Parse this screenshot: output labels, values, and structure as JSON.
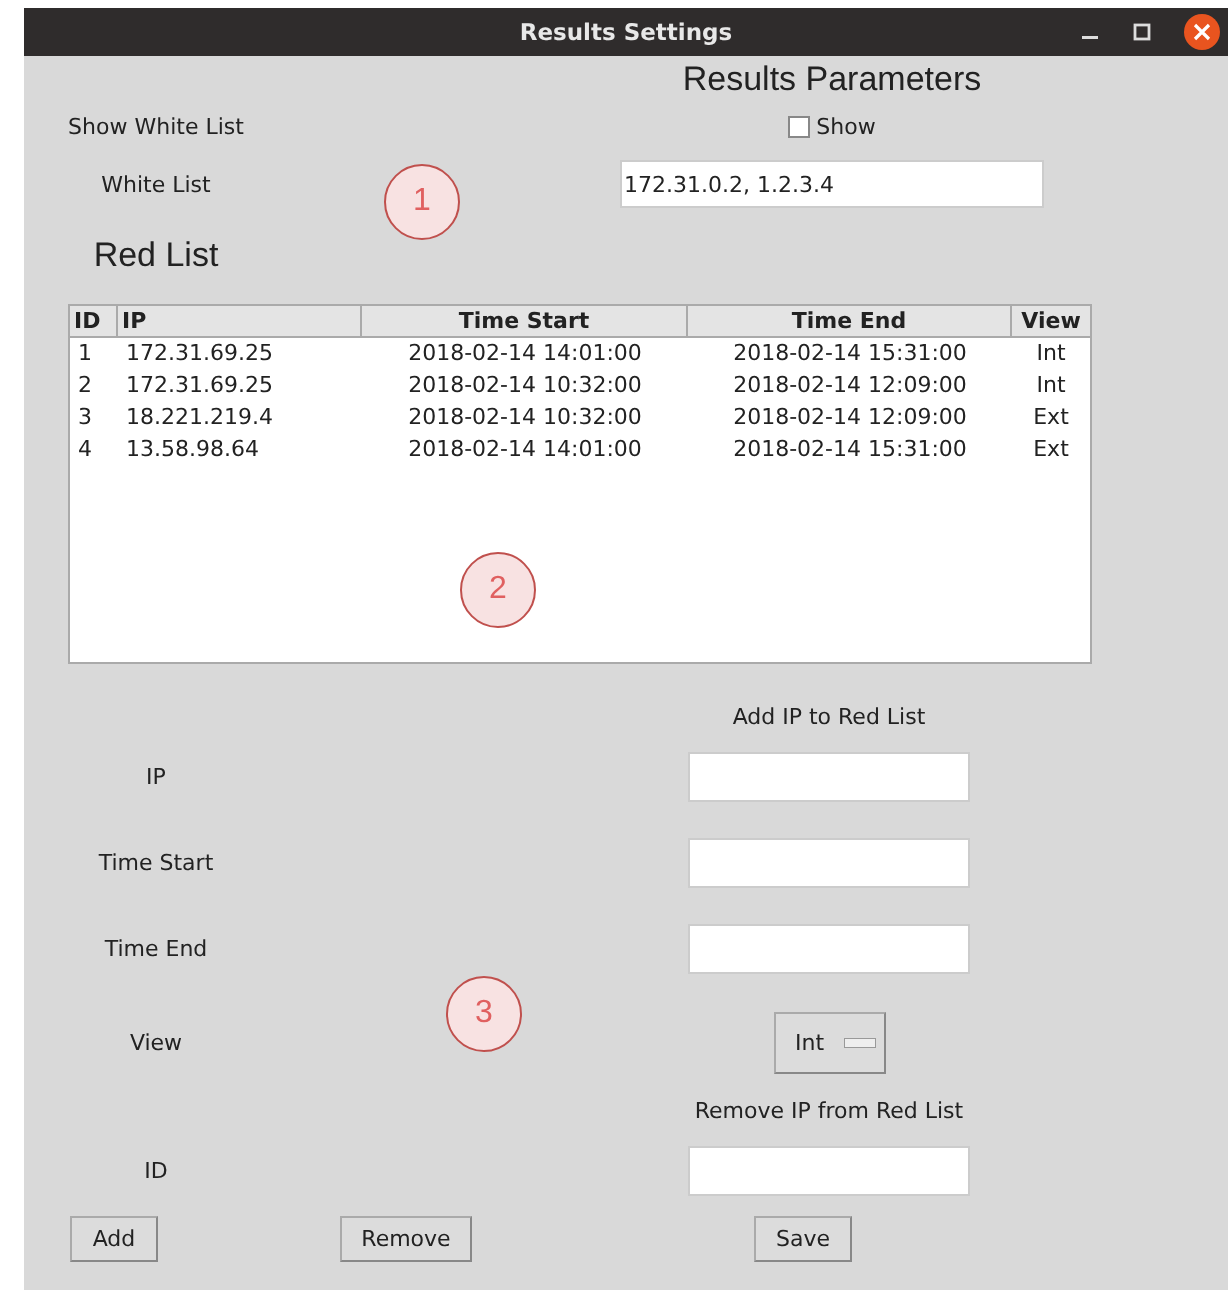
{
  "window": {
    "title": "Results Settings"
  },
  "heading": "Results Parameters",
  "show_white_list": {
    "label": "Show White List",
    "checkbox": {
      "label": "Show",
      "checked": false
    }
  },
  "white_list": {
    "label": "White List",
    "value": "172.31.0.2, 1.2.3.4"
  },
  "red_list": {
    "title": "Red List",
    "table": {
      "columns": [
        "ID",
        "IP",
        "Time Start",
        "Time End",
        "View"
      ],
      "rows": [
        [
          "1",
          "172.31.69.25",
          "2018-02-14 14:01:00",
          "2018-02-14 15:31:00",
          "Int"
        ],
        [
          "2",
          "172.31.69.25",
          "2018-02-14 10:32:00",
          "2018-02-14 12:09:00",
          "Int"
        ],
        [
          "3",
          "18.221.219.4",
          "2018-02-14 10:32:00",
          "2018-02-14 12:09:00",
          "Ext"
        ],
        [
          "4",
          "13.58.98.64",
          "2018-02-14 14:01:00",
          "2018-02-14 15:31:00",
          "Ext"
        ]
      ]
    }
  },
  "add_section": {
    "title": "Add IP to Red List",
    "fields": [
      {
        "label": "IP"
      },
      {
        "label": "Time Start"
      },
      {
        "label": "Time End"
      }
    ],
    "view": {
      "label": "View",
      "value": "Int"
    }
  },
  "remove_section": {
    "title": "Remove IP from Red List",
    "field": {
      "label": "ID"
    }
  },
  "buttons": [
    "Add",
    "Remove",
    "Save"
  ],
  "annotations": [
    "1",
    "2",
    "3"
  ]
}
